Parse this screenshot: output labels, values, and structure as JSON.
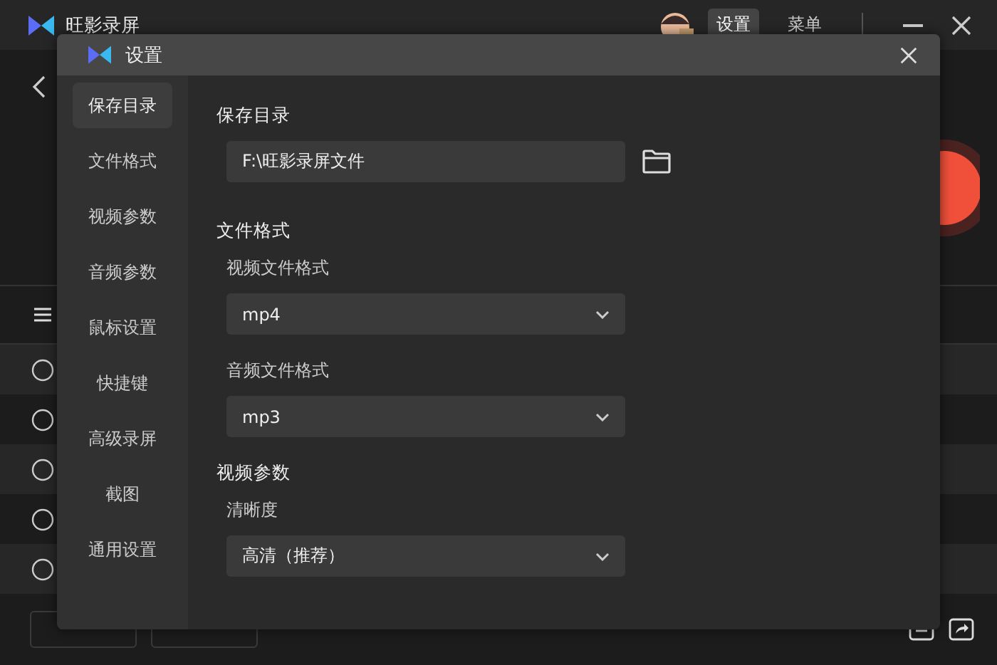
{
  "app": {
    "title": "旺影录屏",
    "header_buttons": [
      {
        "label": "设置",
        "selected": true
      },
      {
        "label": "菜单",
        "selected": false
      }
    ]
  },
  "dialog": {
    "title": "设置",
    "nav": [
      {
        "label": "保存目录",
        "selected": true
      },
      {
        "label": "文件格式",
        "selected": false
      },
      {
        "label": "视频参数",
        "selected": false
      },
      {
        "label": "音频参数",
        "selected": false
      },
      {
        "label": "鼠标设置",
        "selected": false
      },
      {
        "label": "快捷键",
        "selected": false
      },
      {
        "label": "高级录屏",
        "selected": false
      },
      {
        "label": "截图",
        "selected": false
      },
      {
        "label": "通用设置",
        "selected": false
      }
    ],
    "sections": [
      {
        "heading": "保存目录",
        "fields": [
          {
            "kind": "path",
            "value": "F:\\旺影录屏文件"
          }
        ]
      },
      {
        "heading": "文件格式",
        "fields": [
          {
            "kind": "select",
            "label": "视频文件格式",
            "value": "mp4"
          },
          {
            "kind": "select",
            "label": "音频文件格式",
            "value": "mp3"
          }
        ]
      },
      {
        "heading": "视频参数",
        "fields": [
          {
            "kind": "select",
            "label": "清晰度",
            "value": "高清（推荐）"
          }
        ]
      }
    ]
  }
}
